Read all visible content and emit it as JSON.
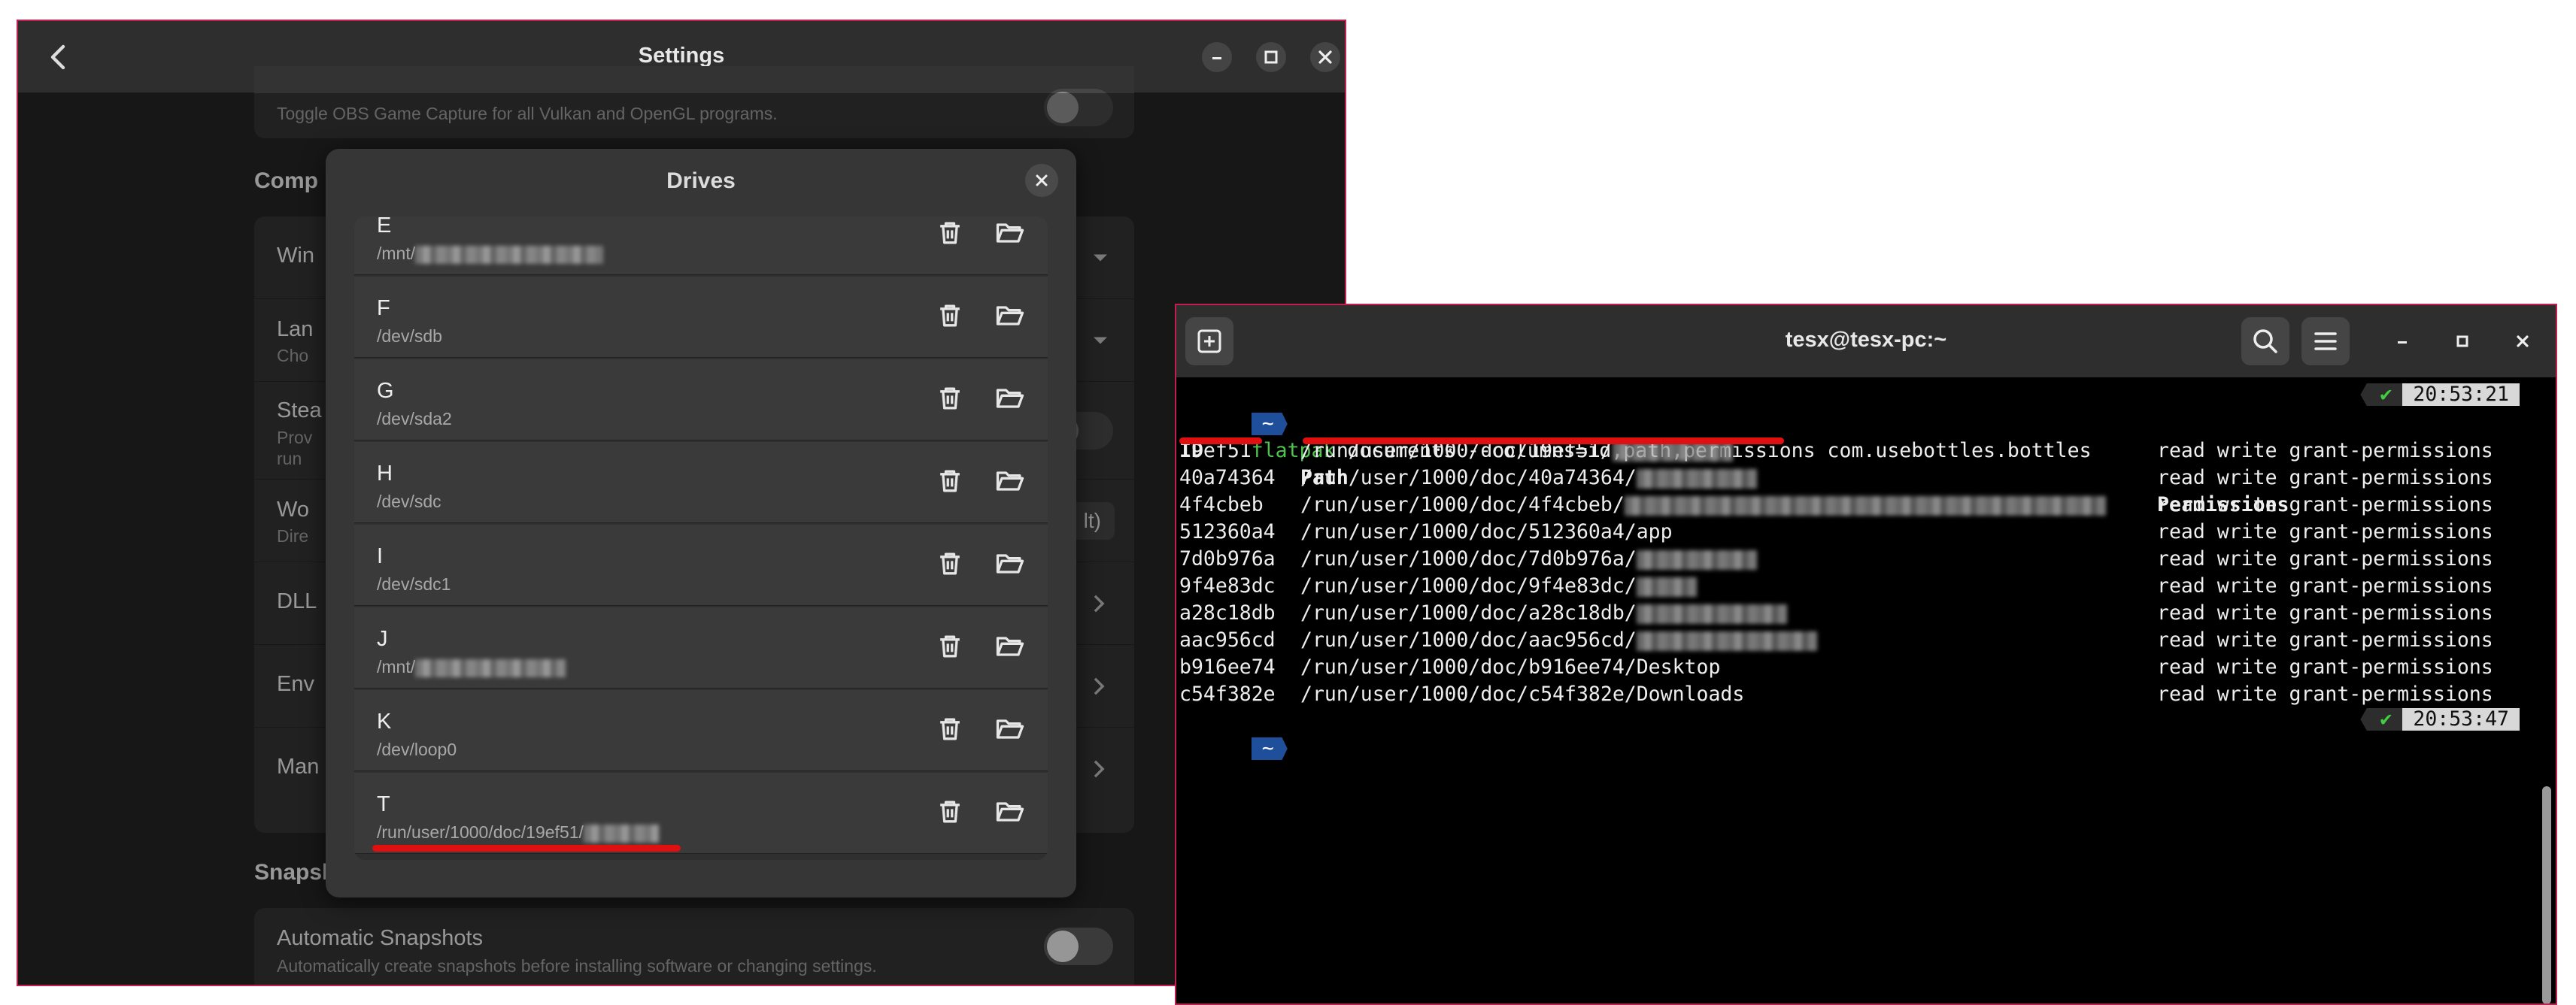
{
  "settings": {
    "title": "Settings",
    "top_row_sub": "Toggle OBS Game Capture for all Vulkan and OpenGL programs.",
    "section_comp": "Comp",
    "rows": [
      {
        "label": "Win",
        "sub": ""
      },
      {
        "label": "Lan",
        "sub": "Cho"
      },
      {
        "label": "Stea",
        "sub": "Prov\nrun"
      },
      {
        "label": "Wo",
        "sub": "Dire",
        "right": "lt)"
      },
      {
        "label": "DLL",
        "sub": ""
      },
      {
        "label": "Env",
        "sub": ""
      },
      {
        "label": "Man",
        "sub": ""
      }
    ],
    "section_snapshots": "Snapshots",
    "auto_snap_label": "Automatic Snapshots",
    "auto_snap_sub": "Automatically create snapshots before installing software or changing settings."
  },
  "drives_dialog": {
    "title": "Drives",
    "drives": [
      {
        "letter": "E",
        "path": "/mnt/"
      },
      {
        "letter": "F",
        "path": "/dev/sdb"
      },
      {
        "letter": "G",
        "path": "/dev/sda2"
      },
      {
        "letter": "H",
        "path": "/dev/sdc"
      },
      {
        "letter": "I",
        "path": "/dev/sdc1"
      },
      {
        "letter": "J",
        "path": "/mnt/"
      },
      {
        "letter": "K",
        "path": "/dev/loop0"
      },
      {
        "letter": "T",
        "path": "/run/user/1000/doc/19ef51/"
      }
    ]
  },
  "terminal": {
    "title": "tesx@tesx-pc:~",
    "prompt": "~",
    "command_name": "flatpak",
    "command_args": " documents --columns=id,path,permissions com.usebottles.bottles",
    "time1": "20:53:21",
    "time2": "20:53:47",
    "check": "✔",
    "header_id": "ID",
    "header_path": "Path",
    "header_perm": "Permissions",
    "rows": [
      {
        "id": "19ef51",
        "path": "/run/user/1000/doc/19ef51/",
        "perm": "read write grant-permissions"
      },
      {
        "id": "40a74364",
        "path": "/run/user/1000/doc/40a74364/",
        "perm": "read write grant-permissions"
      },
      {
        "id": "4f4cbeb",
        "path": "/run/user/1000/doc/4f4cbeb/",
        "perm": "read write grant-permissions"
      },
      {
        "id": "512360a4",
        "path": "/run/user/1000/doc/512360a4/app",
        "perm": "read write grant-permissions"
      },
      {
        "id": "7d0b976a",
        "path": "/run/user/1000/doc/7d0b976a/",
        "perm": "read write grant-permissions"
      },
      {
        "id": "9f4e83dc",
        "path": "/run/user/1000/doc/9f4e83dc/",
        "perm": "read write grant-permissions"
      },
      {
        "id": "a28c18db",
        "path": "/run/user/1000/doc/a28c18db/",
        "perm": "read write grant-permissions"
      },
      {
        "id": "aac956cd",
        "path": "/run/user/1000/doc/aac956cd/",
        "perm": "read write grant-permissions"
      },
      {
        "id": "b916ee74",
        "path": "/run/user/1000/doc/b916ee74/Desktop",
        "perm": "read write grant-permissions"
      },
      {
        "id": "c54f382e",
        "path": "/run/user/1000/doc/c54f382e/Downloads",
        "perm": "read write grant-permissions"
      }
    ]
  },
  "colors": {
    "accent_border": "#c02050",
    "prompt_blue": "#1f4f9a",
    "command_green": "#4ec44e",
    "annotation_red": "#e01010"
  }
}
